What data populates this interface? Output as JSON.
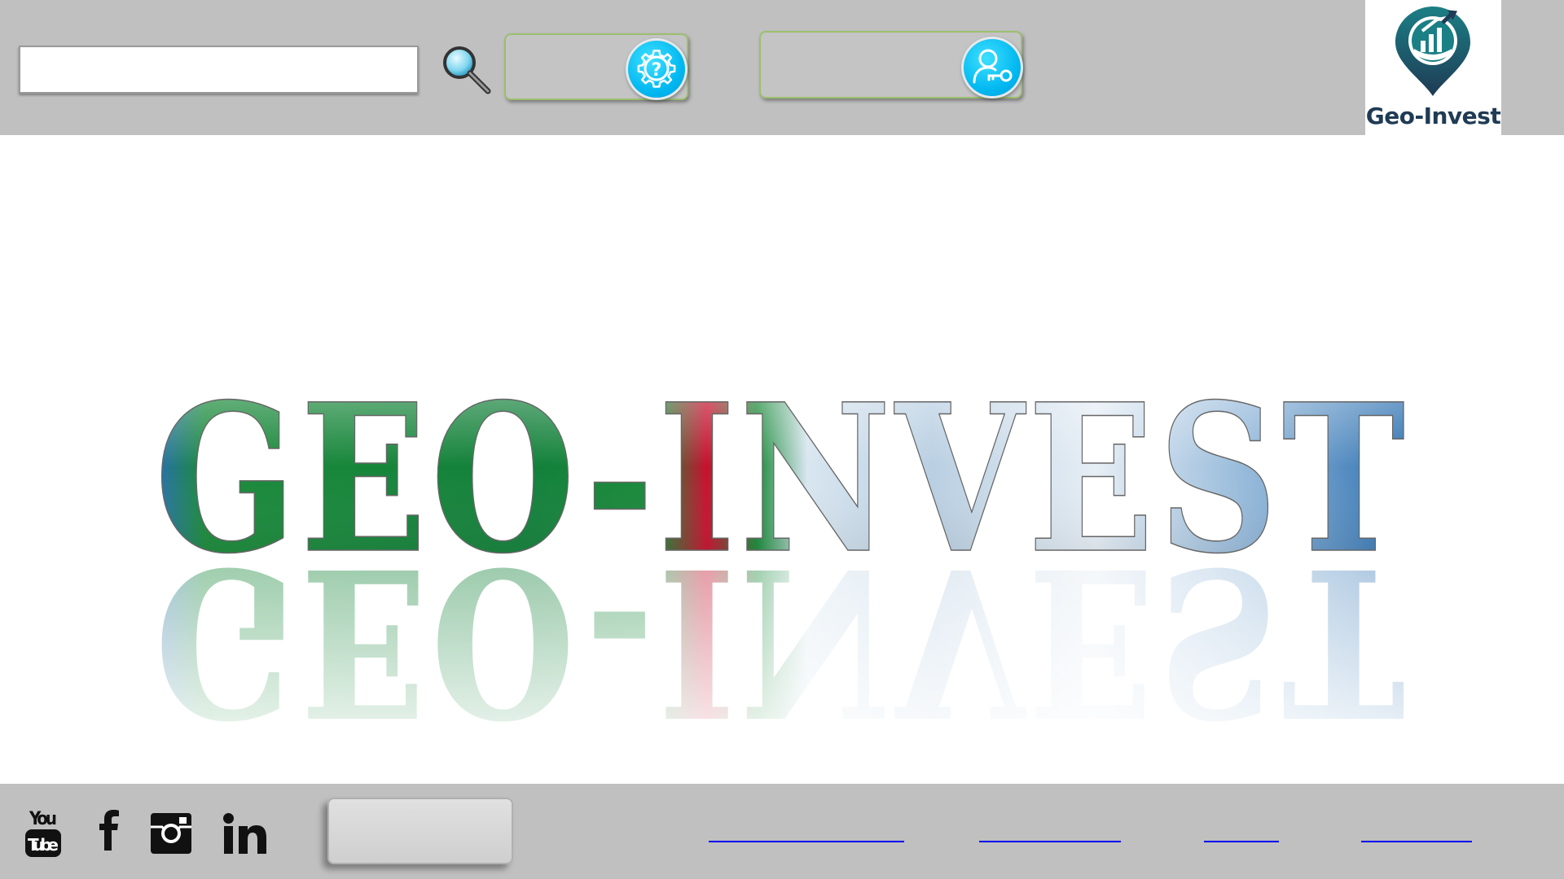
{
  "header": {
    "search": {
      "placeholder": "",
      "value": ""
    },
    "help_button": {
      "label": ""
    },
    "account_button": {
      "label": ""
    },
    "logo": {
      "text": "Geo-Invest"
    }
  },
  "hero": {
    "wordmark": "GEO-INVEST"
  },
  "footer": {
    "social": [
      "YouTube",
      "Facebook",
      "Instagram",
      "LinkedIn"
    ],
    "button": {
      "label": ""
    },
    "links": [
      "",
      "",
      "",
      ""
    ]
  },
  "colors": {
    "header_bg": "#c0c0c0",
    "accent_cyan": "#00b7f0",
    "logo_navy": "#1f3b55",
    "logo_teal": "#1b7f86",
    "flag_green": "#1a8a3a",
    "flag_red": "#c8102e",
    "flag_blue": "#2a6fb0",
    "link_blue": "#0000ee"
  }
}
